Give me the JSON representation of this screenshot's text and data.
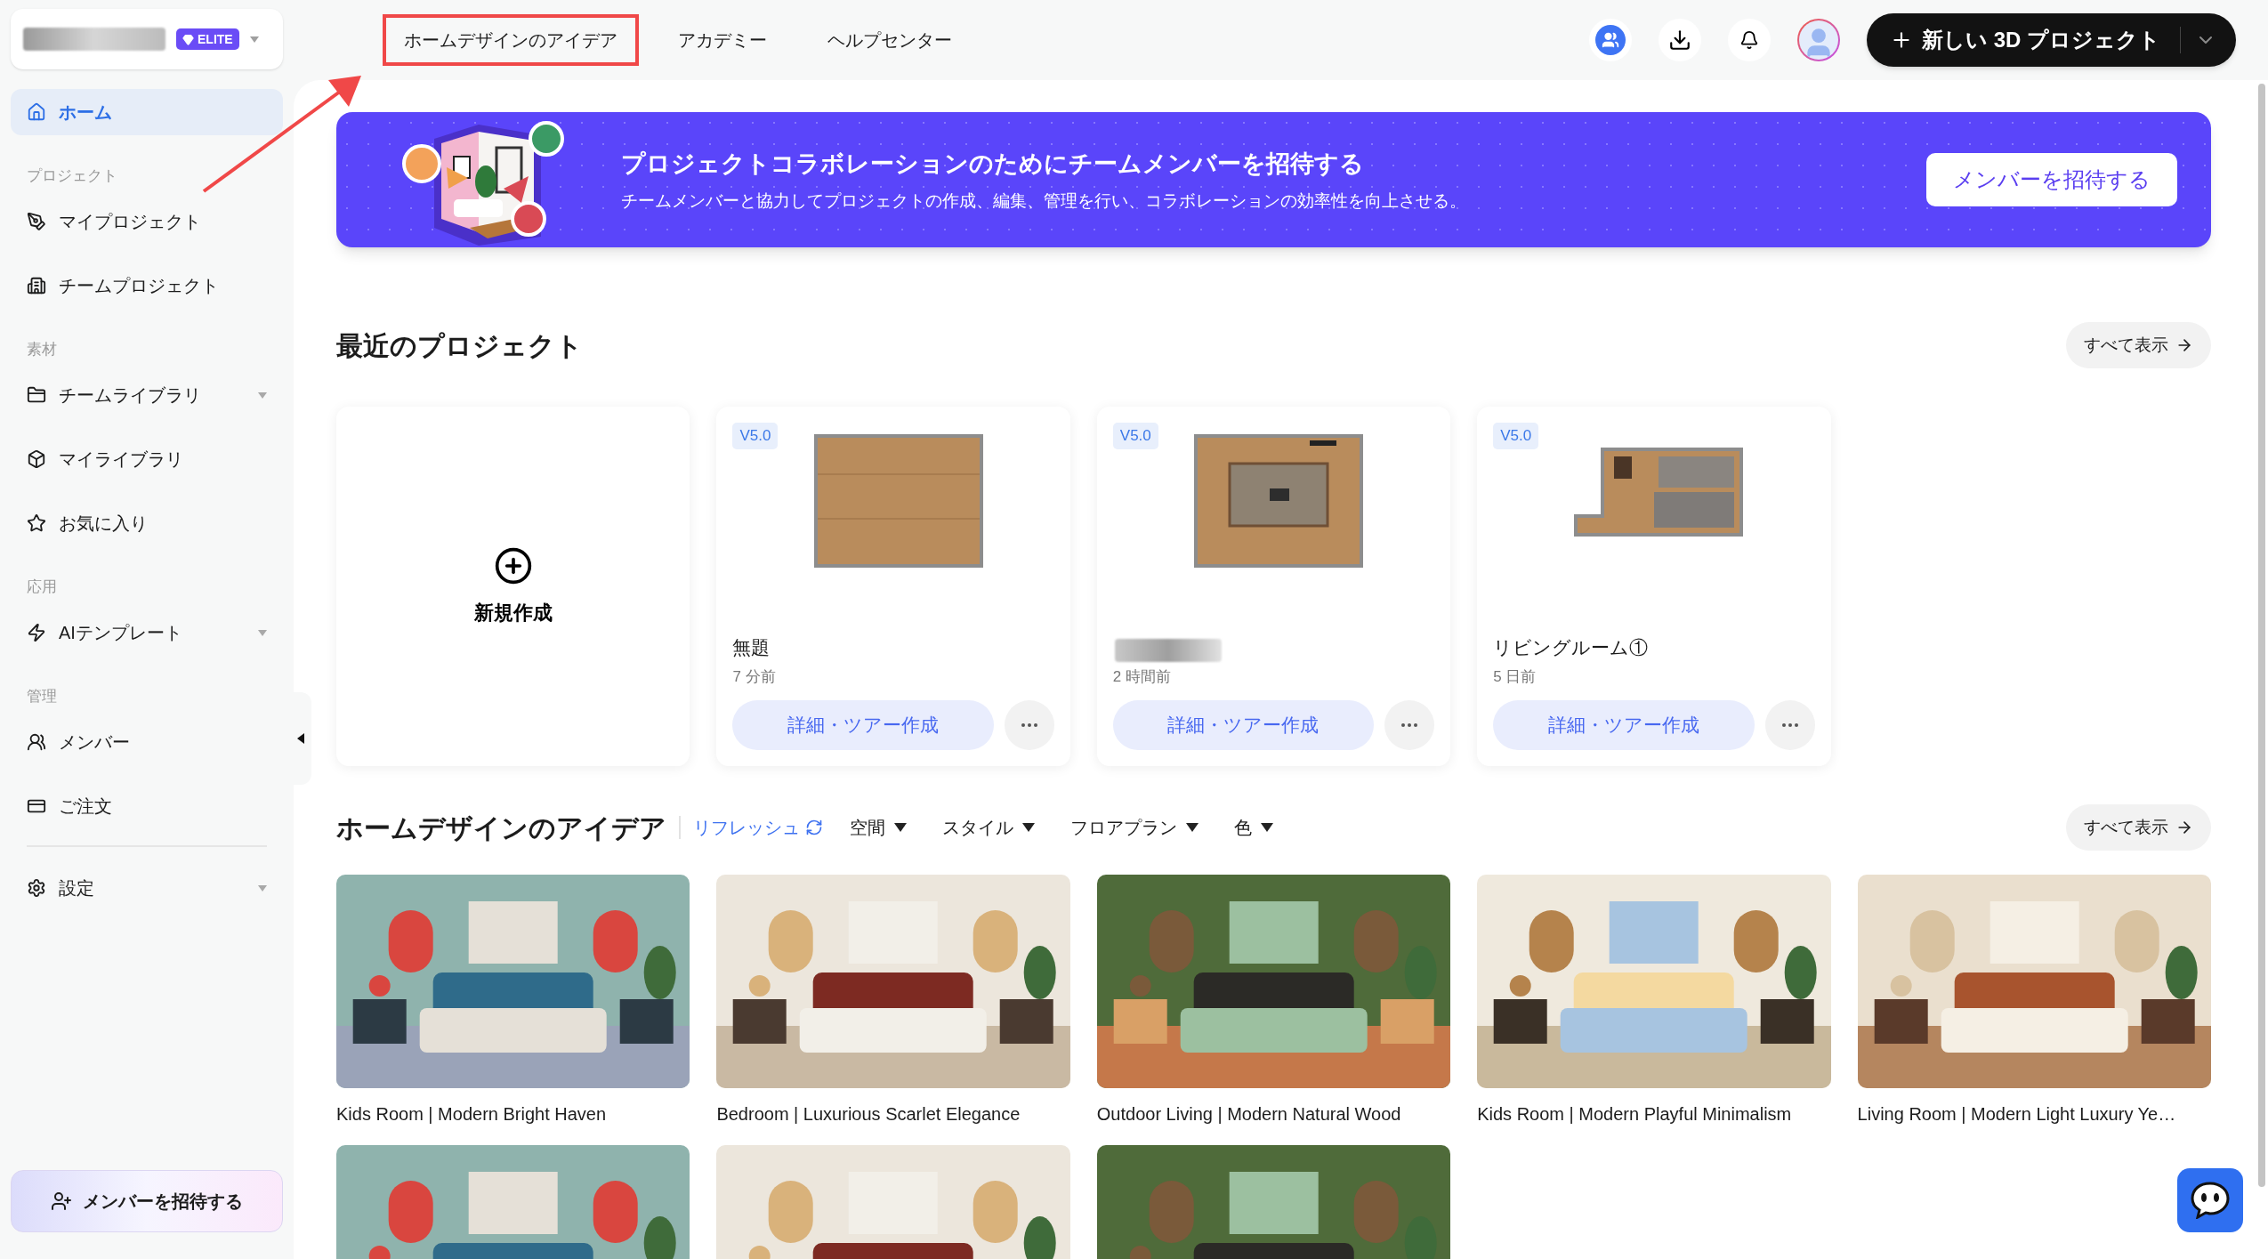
{
  "account": {
    "name_blurred": true,
    "plan_badge": "ELITE"
  },
  "top_nav": [
    {
      "label": "ホームデザインのアイデア",
      "highlighted": true
    },
    {
      "label": "アカデミー",
      "highlighted": false
    },
    {
      "label": "ヘルプセンター",
      "highlighted": false
    }
  ],
  "new_project_button": {
    "label": "新しい 3D プロジェクト"
  },
  "sidebar": {
    "items": [
      {
        "kind": "item",
        "label": "ホーム",
        "selected": true,
        "expandable": false
      },
      {
        "kind": "section",
        "label": "プロジェクト"
      },
      {
        "kind": "item",
        "label": "マイプロジェクト",
        "selected": false,
        "expandable": false
      },
      {
        "kind": "item",
        "label": "チームプロジェクト",
        "selected": false,
        "expandable": false
      },
      {
        "kind": "section",
        "label": "素材"
      },
      {
        "kind": "item",
        "label": "チームライブラリ",
        "selected": false,
        "expandable": true
      },
      {
        "kind": "item",
        "label": "マイライブラリ",
        "selected": false,
        "expandable": false
      },
      {
        "kind": "item",
        "label": "お気に入り",
        "selected": false,
        "expandable": false
      },
      {
        "kind": "section",
        "label": "応用"
      },
      {
        "kind": "item",
        "label": "AIテンプレート",
        "selected": false,
        "expandable": true
      },
      {
        "kind": "section",
        "label": "管理"
      },
      {
        "kind": "item",
        "label": "メンバー",
        "selected": false,
        "expandable": false
      },
      {
        "kind": "item",
        "label": "ご注文",
        "selected": false,
        "expandable": false
      },
      {
        "kind": "divider"
      },
      {
        "kind": "item",
        "label": "設定",
        "selected": false,
        "expandable": true
      }
    ],
    "invite_button": "メンバーを招待する"
  },
  "banner": {
    "title": "プロジェクトコラボレーションのためにチームメンバーを招待する",
    "text": "チームメンバーと協力してプロジェクトの作成、編集、管理を行い、コラボレーションの効率性を向上させる。",
    "button": "メンバーを招待する"
  },
  "recent": {
    "title": "最近のプロジェクト",
    "view_all": "すべて表示",
    "new_card": "新規作成",
    "projects": [
      {
        "version": "V5.0",
        "name": "無題",
        "name_blurred": false,
        "time": "7 分前",
        "action": "詳細・ツアー作成"
      },
      {
        "version": "V5.0",
        "name_blurred": true,
        "time": "2 時間前",
        "action": "詳細・ツアー作成"
      },
      {
        "version": "V5.0",
        "name": "リビングルーム①",
        "name_blurred": false,
        "time": "5 日前",
        "action": "詳細・ツアー作成"
      }
    ]
  },
  "ideas": {
    "title": "ホームデザインのアイデア",
    "refresh": "リフレッシュ",
    "filters": [
      "空間",
      "スタイル",
      "フロアプラン",
      "色"
    ],
    "view_all": "すべて表示",
    "items": [
      {
        "kind": "picture",
        "caption": "Kids Room | Modern Bright Haven"
      },
      {
        "kind": "picture",
        "caption": "Bedroom | Luxurious Scarlet Elegance"
      },
      {
        "kind": "picture",
        "caption": "Outdoor Living | Modern Natural Wood"
      },
      {
        "kind": "picture",
        "caption": "Kids Room | Modern Playful Minimalism"
      },
      {
        "kind": "picture",
        "caption": "Living Room | Modern Light Luxury Ye…"
      },
      {
        "kind": "picture"
      },
      {
        "kind": "picture"
      },
      {
        "kind": "picture"
      }
    ]
  }
}
